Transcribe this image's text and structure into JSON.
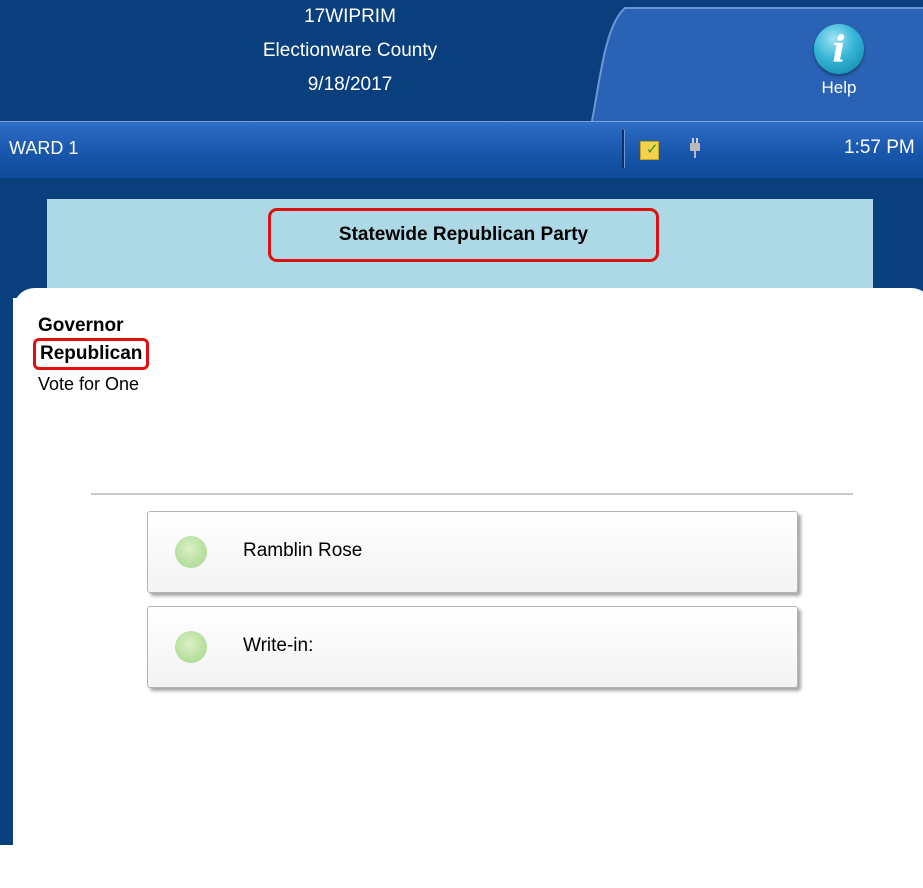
{
  "header": {
    "election_code": "17WIPRIM",
    "county": "Electionware County",
    "date": "9/18/2017",
    "help_label": "Help"
  },
  "status_bar": {
    "ward": "WARD 1",
    "time": "1:57 PM",
    "icons": [
      "note-check-icon",
      "plug-icon"
    ]
  },
  "ballot": {
    "party_heading": "Statewide Republican Party",
    "contest": {
      "name": "Governor",
      "party": "Republican",
      "instruction": "Vote for One"
    },
    "choices": [
      {
        "label": "Ramblin Rose",
        "selected": false
      },
      {
        "label": "Write-in:",
        "selected": false
      }
    ]
  },
  "colors": {
    "header_bg": "#0a3f7e",
    "status_bar": "#1958ad",
    "party_panel": "#add8e6",
    "highlight_border": "#e01010",
    "choice_dot": "#b8e0a0"
  }
}
